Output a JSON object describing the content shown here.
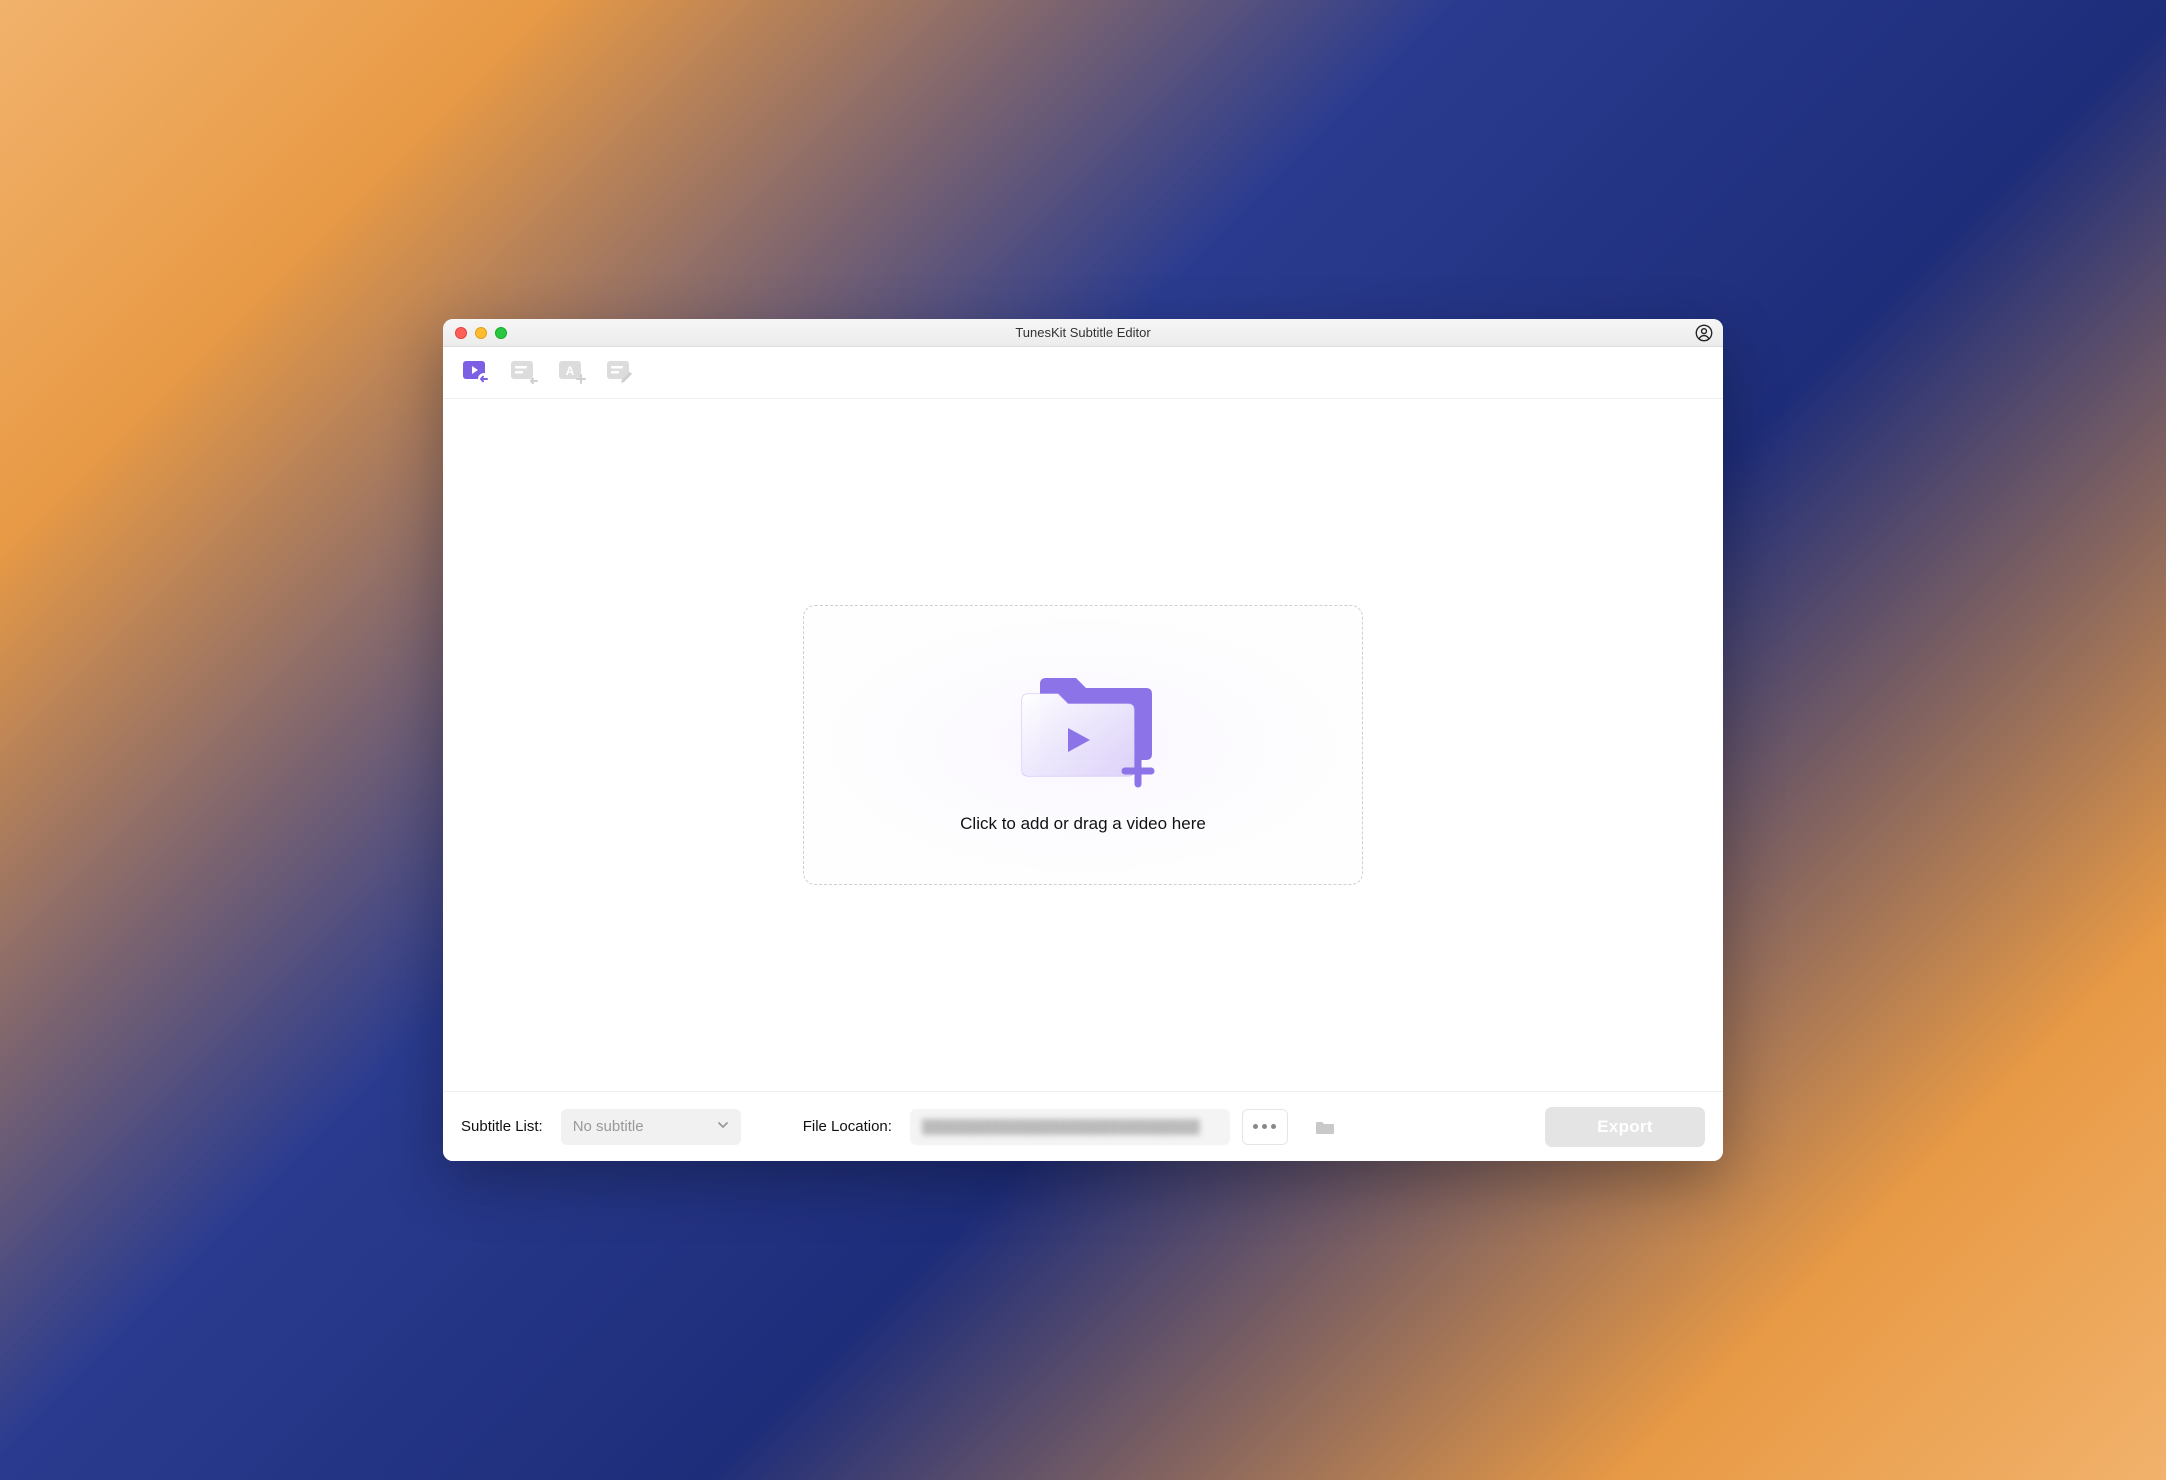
{
  "window": {
    "title": "TunesKit Subtitle Editor"
  },
  "toolbar": {
    "icons": [
      "video-import",
      "subtitle-import",
      "subtitle-style",
      "subtitle-edit"
    ]
  },
  "dropzone": {
    "text": "Click to add or drag a video here"
  },
  "footer": {
    "subtitle_list_label": "Subtitle List:",
    "subtitle_list_value": "No subtitle",
    "file_location_label": "File Location:",
    "file_location_value": "",
    "export_label": "Export"
  },
  "colors": {
    "accent": "#8a72e8"
  }
}
